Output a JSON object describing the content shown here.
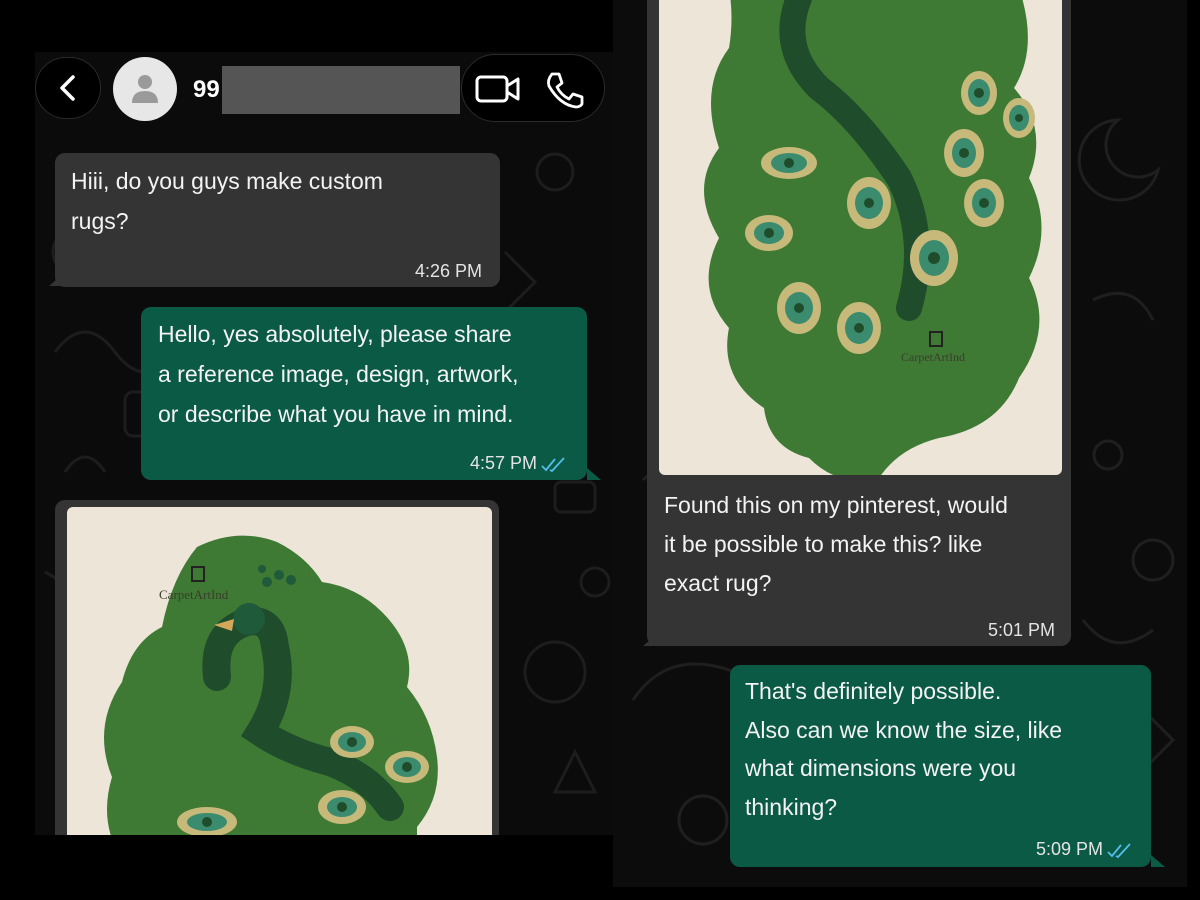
{
  "contact": {
    "name_visible": "99"
  },
  "messages": [
    {
      "direction": "incoming",
      "text": [
        "Hiii, do you guys make custom",
        "rugs?"
      ],
      "time": "4:26 PM"
    },
    {
      "direction": "outgoing",
      "text": [
        "Hello, yes absolutely, please share",
        "a reference image, design, artwork,",
        "or describe what you have in mind."
      ],
      "time": "4:57 PM",
      "status": "read"
    },
    {
      "direction": "incoming",
      "type": "image",
      "caption": [
        "Found this on my pinterest, would",
        "it be possible to make this? like",
        "exact rug?"
      ],
      "time": "5:01 PM"
    },
    {
      "direction": "outgoing",
      "text": [
        "That's definitely possible.",
        "Also can we know the size, like",
        "what dimensions were you",
        "thinking?"
      ],
      "time": "5:09 PM",
      "status": "read"
    }
  ],
  "image": {
    "logo_text": "CarpetArtInd"
  },
  "colors": {
    "incoming_bubble": "#343434",
    "outgoing_bubble": "#0a5a45",
    "read_ticks": "#53bdeb",
    "rug_green": "#3f7a35",
    "rug_background": "#ece5d8"
  },
  "icons": [
    "back-arrow-icon",
    "person-icon",
    "video-call-icon",
    "phone-icon",
    "double-check-icon"
  ]
}
